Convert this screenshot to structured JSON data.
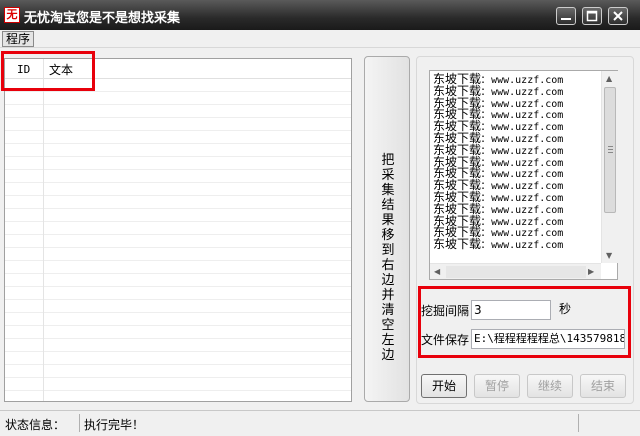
{
  "window": {
    "icon_char": "无",
    "title": "无忧淘宝您是不是想找采集"
  },
  "menu": {
    "items": [
      "程序"
    ]
  },
  "list": {
    "columns": [
      "ID",
      "文本"
    ]
  },
  "move_button": {
    "label": "把采集结果移到右边并清空左边"
  },
  "log": {
    "lines": [
      {
        "zh": "东坡下载:",
        "en": " www.uzzf.com"
      },
      {
        "zh": "东坡下载:",
        "en": " www.uzzf.com"
      },
      {
        "zh": "东坡下载:",
        "en": " www.uzzf.com"
      },
      {
        "zh": "东坡下载:",
        "en": " www.uzzf.com"
      },
      {
        "zh": "东坡下载:",
        "en": " www.uzzf.com"
      },
      {
        "zh": "东坡下载:",
        "en": " www.uzzf.com"
      },
      {
        "zh": "东坡下载:",
        "en": " www.uzzf.com"
      },
      {
        "zh": "东坡下载:",
        "en": " www.uzzf.com"
      },
      {
        "zh": "东坡下载:",
        "en": " www.uzzf.com"
      },
      {
        "zh": "东坡下载:",
        "en": " www.uzzf.com"
      },
      {
        "zh": "东坡下载:",
        "en": " www.uzzf.com"
      },
      {
        "zh": "东坡下载:",
        "en": " www.uzzf.com"
      },
      {
        "zh": "东坡下载:",
        "en": " www.uzzf.com"
      },
      {
        "zh": "东坡下载:",
        "en": " www.uzzf.com"
      },
      {
        "zh": "东坡下载:",
        "en": " www.uzzf.com"
      }
    ]
  },
  "settings": {
    "interval_label": "挖掘间隔",
    "interval_value": "3",
    "interval_unit": "秒",
    "save_label": "文件保存",
    "save_path": "E:\\程程程程程总\\143579818"
  },
  "buttons": {
    "start": "开始",
    "pause": "暂停",
    "resume": "继续",
    "stop": "结束"
  },
  "status": {
    "label": "状态信息：",
    "value": "执行完毕！"
  },
  "colors": {
    "highlight_box": "#e8000b",
    "titlebar": "#2a2a2a"
  }
}
